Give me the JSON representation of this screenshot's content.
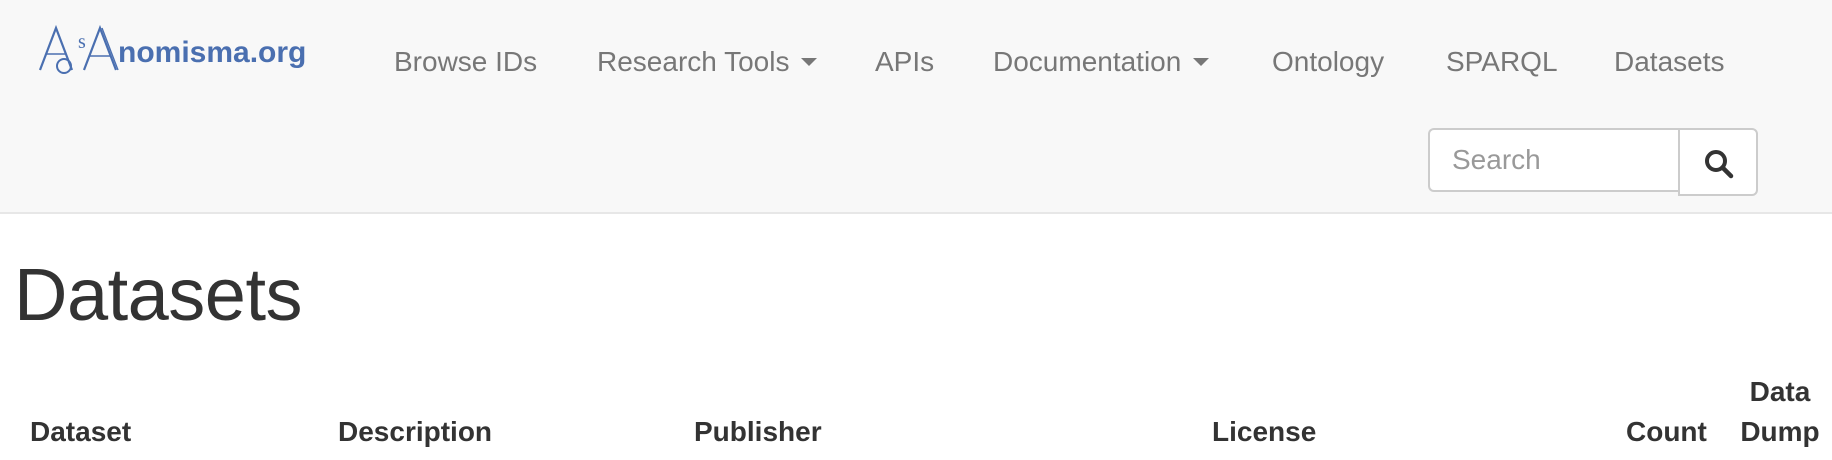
{
  "header": {
    "brand_name": "nomisma.org",
    "logo_letters": "AoSA",
    "nav_items": [
      {
        "label": "Browse IDs",
        "dropdown": false
      },
      {
        "label": "Research Tools",
        "dropdown": true
      },
      {
        "label": "APIs",
        "dropdown": false
      },
      {
        "label": "Documentation",
        "dropdown": true
      },
      {
        "label": "Ontology",
        "dropdown": false
      },
      {
        "label": "SPARQL",
        "dropdown": false
      },
      {
        "label": "Datasets",
        "dropdown": false
      }
    ],
    "search": {
      "placeholder": "Search",
      "value": ""
    }
  },
  "main": {
    "title": "Datasets",
    "table": {
      "columns": [
        "Dataset",
        "Description",
        "Publisher",
        "License",
        "Count",
        "Data Dump"
      ],
      "data_dump_line1": "Data",
      "data_dump_line2": "Dump"
    }
  },
  "colors": {
    "navbar_bg": "#f8f8f8",
    "nav_text": "#777777",
    "logo_blue": "#4a6fb0",
    "text": "#333333"
  }
}
